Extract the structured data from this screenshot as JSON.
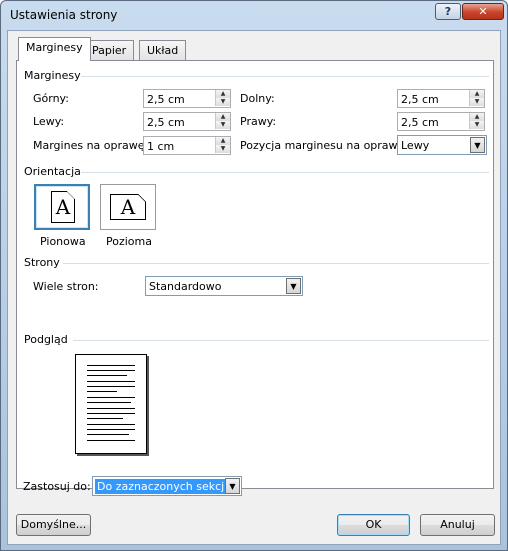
{
  "window": {
    "title": "Ustawienia strony"
  },
  "tabs": [
    {
      "label": "Marginesy",
      "active": true
    },
    {
      "label": "Papier",
      "active": false
    },
    {
      "label": "Układ",
      "active": false
    }
  ],
  "margins": {
    "section_label": "Marginesy",
    "top": {
      "label": "Górny:",
      "value": "2,5 cm"
    },
    "bottom": {
      "label": "Dolny:",
      "value": "2,5 cm"
    },
    "left": {
      "label": "Lewy:",
      "value": "2,5 cm"
    },
    "right": {
      "label": "Prawy:",
      "value": "2,5 cm"
    },
    "gutter": {
      "label": "Margines na oprawę:",
      "value": "1 cm"
    },
    "gutter_position": {
      "label": "Pozycja marginesu na oprawę:",
      "value": "Lewy"
    }
  },
  "orientation": {
    "section_label": "Orientacja",
    "portrait": {
      "label": "Pionowa",
      "glyph": "A",
      "selected": true
    },
    "landscape": {
      "label": "Pozioma",
      "glyph": "A",
      "selected": false
    }
  },
  "pages": {
    "section_label": "Strony",
    "multiple_pages_label": "Wiele stron:",
    "multiple_pages_value": "Standardowo"
  },
  "preview": {
    "section_label": "Podgląd"
  },
  "apply": {
    "label": "Zastosuj do:",
    "value": "Do zaznaczonych sekcji"
  },
  "buttons": {
    "default": "Domyślne...",
    "ok": "OK",
    "cancel": "Anuluj"
  },
  "colors": {
    "accent": "#3c7fb1",
    "selection": "#3399ff",
    "close": "#c8452a"
  }
}
